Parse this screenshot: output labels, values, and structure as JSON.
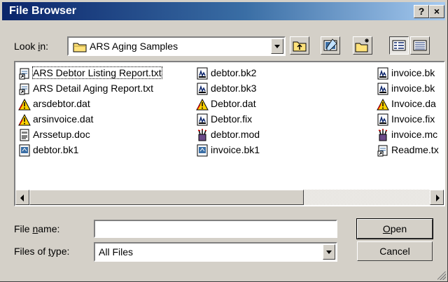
{
  "window": {
    "title": "File Browser",
    "help_label": "?",
    "close_label": "×"
  },
  "lookin": {
    "label_prefix": "Look ",
    "label_key": "i",
    "label_suffix": "n:",
    "value": "ARS Aging Samples"
  },
  "files": {
    "col1": [
      {
        "name": "ARS Debtor Listing Report.txt",
        "icon": "shortcut-icon"
      },
      {
        "name": "ARS Detail Aging Report.txt",
        "icon": "shortcut-icon"
      },
      {
        "name": "arsdebtor.dat",
        "icon": "dat-file-icon"
      },
      {
        "name": "arsinvoice.dat",
        "icon": "dat-file-icon"
      },
      {
        "name": "Arssetup.doc",
        "icon": "doc-file-icon"
      },
      {
        "name": "debtor.bk1",
        "icon": "bk-file-icon"
      }
    ],
    "col2": [
      {
        "name": "debtor.bk2",
        "icon": "bk2-file-icon"
      },
      {
        "name": "debtor.bk3",
        "icon": "bk2-file-icon"
      },
      {
        "name": "Debtor.dat",
        "icon": "dat-file-icon"
      },
      {
        "name": "Debtor.fix",
        "icon": "bk2-file-icon"
      },
      {
        "name": "debtor.mod",
        "icon": "mod-file-icon"
      },
      {
        "name": "invoice.bk1",
        "icon": "bk-file-icon"
      }
    ],
    "col3": [
      {
        "name": "invoice.bk",
        "icon": "bk2-file-icon"
      },
      {
        "name": "invoice.bk",
        "icon": "bk2-file-icon"
      },
      {
        "name": "Invoice.da",
        "icon": "dat-file-icon"
      },
      {
        "name": "Invoice.fix",
        "icon": "bk2-file-icon"
      },
      {
        "name": "invoice.mc",
        "icon": "mod-file-icon"
      },
      {
        "name": "Readme.tx",
        "icon": "shortcut-icon"
      }
    ]
  },
  "filename": {
    "label_prefix": "File ",
    "label_key": "n",
    "label_suffix": "ame:",
    "value": ""
  },
  "filetype": {
    "label_prefix": "Files of ",
    "label_key": "t",
    "label_suffix": "ype:",
    "value": "All Files"
  },
  "buttons": {
    "open_key": "O",
    "open_rest": "pen",
    "cancel": "Cancel"
  }
}
